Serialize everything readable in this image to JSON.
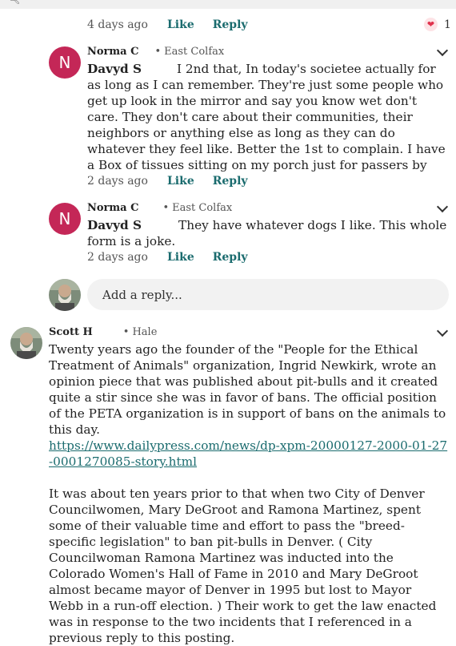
{
  "top_comment": {
    "time": "4 days ago",
    "like_label": "Like",
    "reply_label": "Reply",
    "reaction_count": "1"
  },
  "replies": [
    {
      "initial": "N",
      "author": "Norma C",
      "location": "East Colfax",
      "mention": "Davyd S",
      "text": "I 2nd that, In today's societee actually for as long as I can remember. They're just some people who get up look in the mirror and say you know wet don't care. They don't care about their communities, their neighbors or anything else as long as they can do whatever they feel like. Better the 1st to complain. I have a Box of tissues sitting on my porch just for passers by",
      "time": "2 days ago",
      "like_label": "Like",
      "reply_label": "Reply"
    },
    {
      "initial": "N",
      "author": "Norma C",
      "location": "East Colfax",
      "mention": "Davyd S",
      "text": "They  have whatever dogs I like.  This whole form is a joke.",
      "time": "2 days ago",
      "like_label": "Like",
      "reply_label": "Reply"
    }
  ],
  "reply_box": {
    "placeholder": "Add a reply..."
  },
  "main_comment": {
    "author": "Scott H",
    "location": "Hale",
    "para1": "Twenty years ago the founder of the \"People for the Ethical Treatment of Animals\" organization, Ingrid Newkirk, wrote an opinion piece that was published about pit-bulls and it created quite a stir since she was in favor of bans. The official position of the PETA organization is in support of bans on the animals to this day.",
    "link": "https://www.dailypress.com/news/dp-xpm-20000127-2000-01-27-0001270085-story.html",
    "para2": "It was about ten years prior to that when two City of Denver Councilwomen, Mary DeGroot and Ramona Martinez, spent some of their valuable time and effort to pass the \"breed-specific legislation\" to ban pit-bulls in Denver. ( City Councilwoman Ramona Martinez was inducted into the Colorado Women's Hall of Fame in 2010 and Mary DeGroot almost became mayor of Denver in 1995 but lost to Mayor Webb in a run-off election. ) Their work to get the law enacted was in response to the two incidents that I referenced in a previous reply to this posting."
  },
  "icons": {
    "search": "search-icon",
    "heart": "heart-icon",
    "chevron": "chevron-down-icon"
  }
}
